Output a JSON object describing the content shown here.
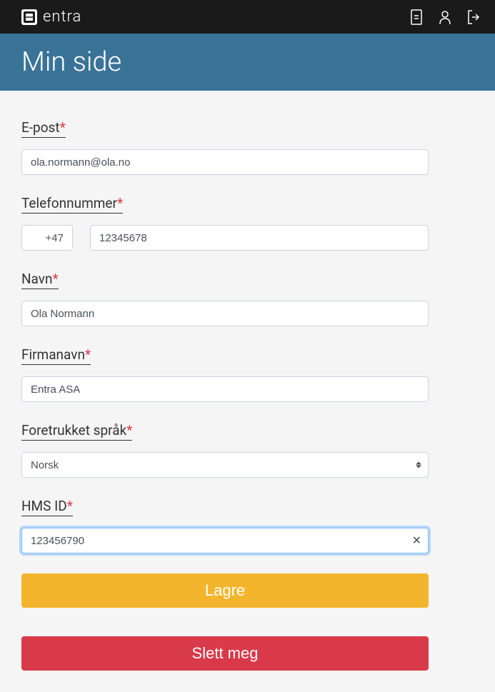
{
  "header": {
    "logo_text": "entra"
  },
  "page": {
    "title": "Min side"
  },
  "form": {
    "email": {
      "label": "E-post",
      "value": "ola.normann@ola.no"
    },
    "phone": {
      "label": "Telefonnummer",
      "country_code": "+47",
      "number": "12345678"
    },
    "name": {
      "label": "Navn",
      "value": "Ola Normann"
    },
    "company": {
      "label": "Firmanavn",
      "value": "Entra ASA"
    },
    "language": {
      "label": "Foretrukket språk",
      "selected": "Norsk"
    },
    "hms_id": {
      "label": "HMS ID",
      "value": "123456790"
    },
    "required_marker": "*"
  },
  "buttons": {
    "save": "Lagre",
    "delete": "Slett meg"
  }
}
